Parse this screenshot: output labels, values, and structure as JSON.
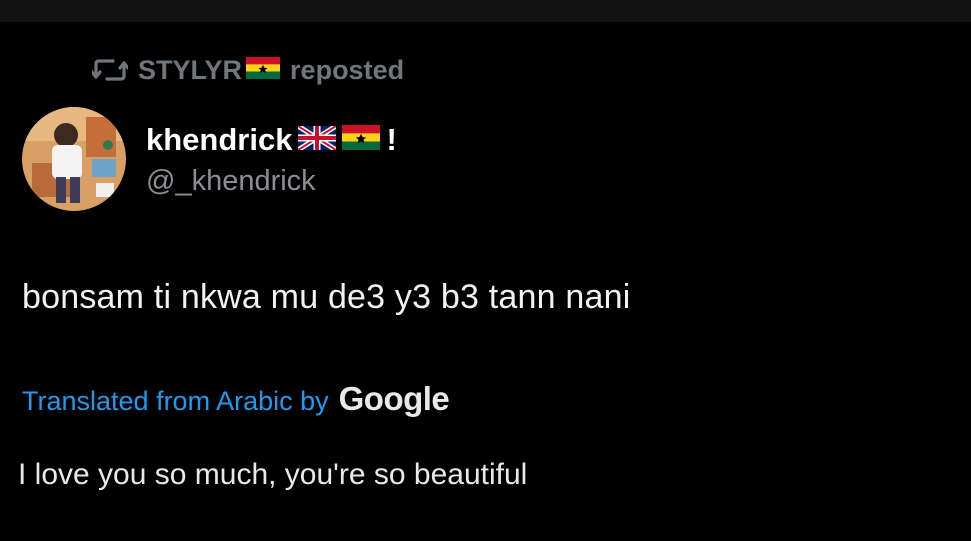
{
  "repost": {
    "icon": "repost-icon",
    "user": "STYLYR",
    "user_flag": "ghana-flag",
    "action": "reposted"
  },
  "author": {
    "avatar": "avatar",
    "display_name": "khendrick",
    "name_flags": [
      "uk-flag",
      "ghana-flag"
    ],
    "name_suffix": "!",
    "handle": "@_khendrick"
  },
  "tweet": {
    "text": "bonsam ti nkwa mu de3 y3 b3 tann nani"
  },
  "translation": {
    "label": "Translated from Arabic by",
    "provider": "Google",
    "text": "I love you so much, you're so beautiful"
  },
  "colors": {
    "background": "#000000",
    "link_blue": "#1d9bf0",
    "muted_gray": "#71767b"
  }
}
